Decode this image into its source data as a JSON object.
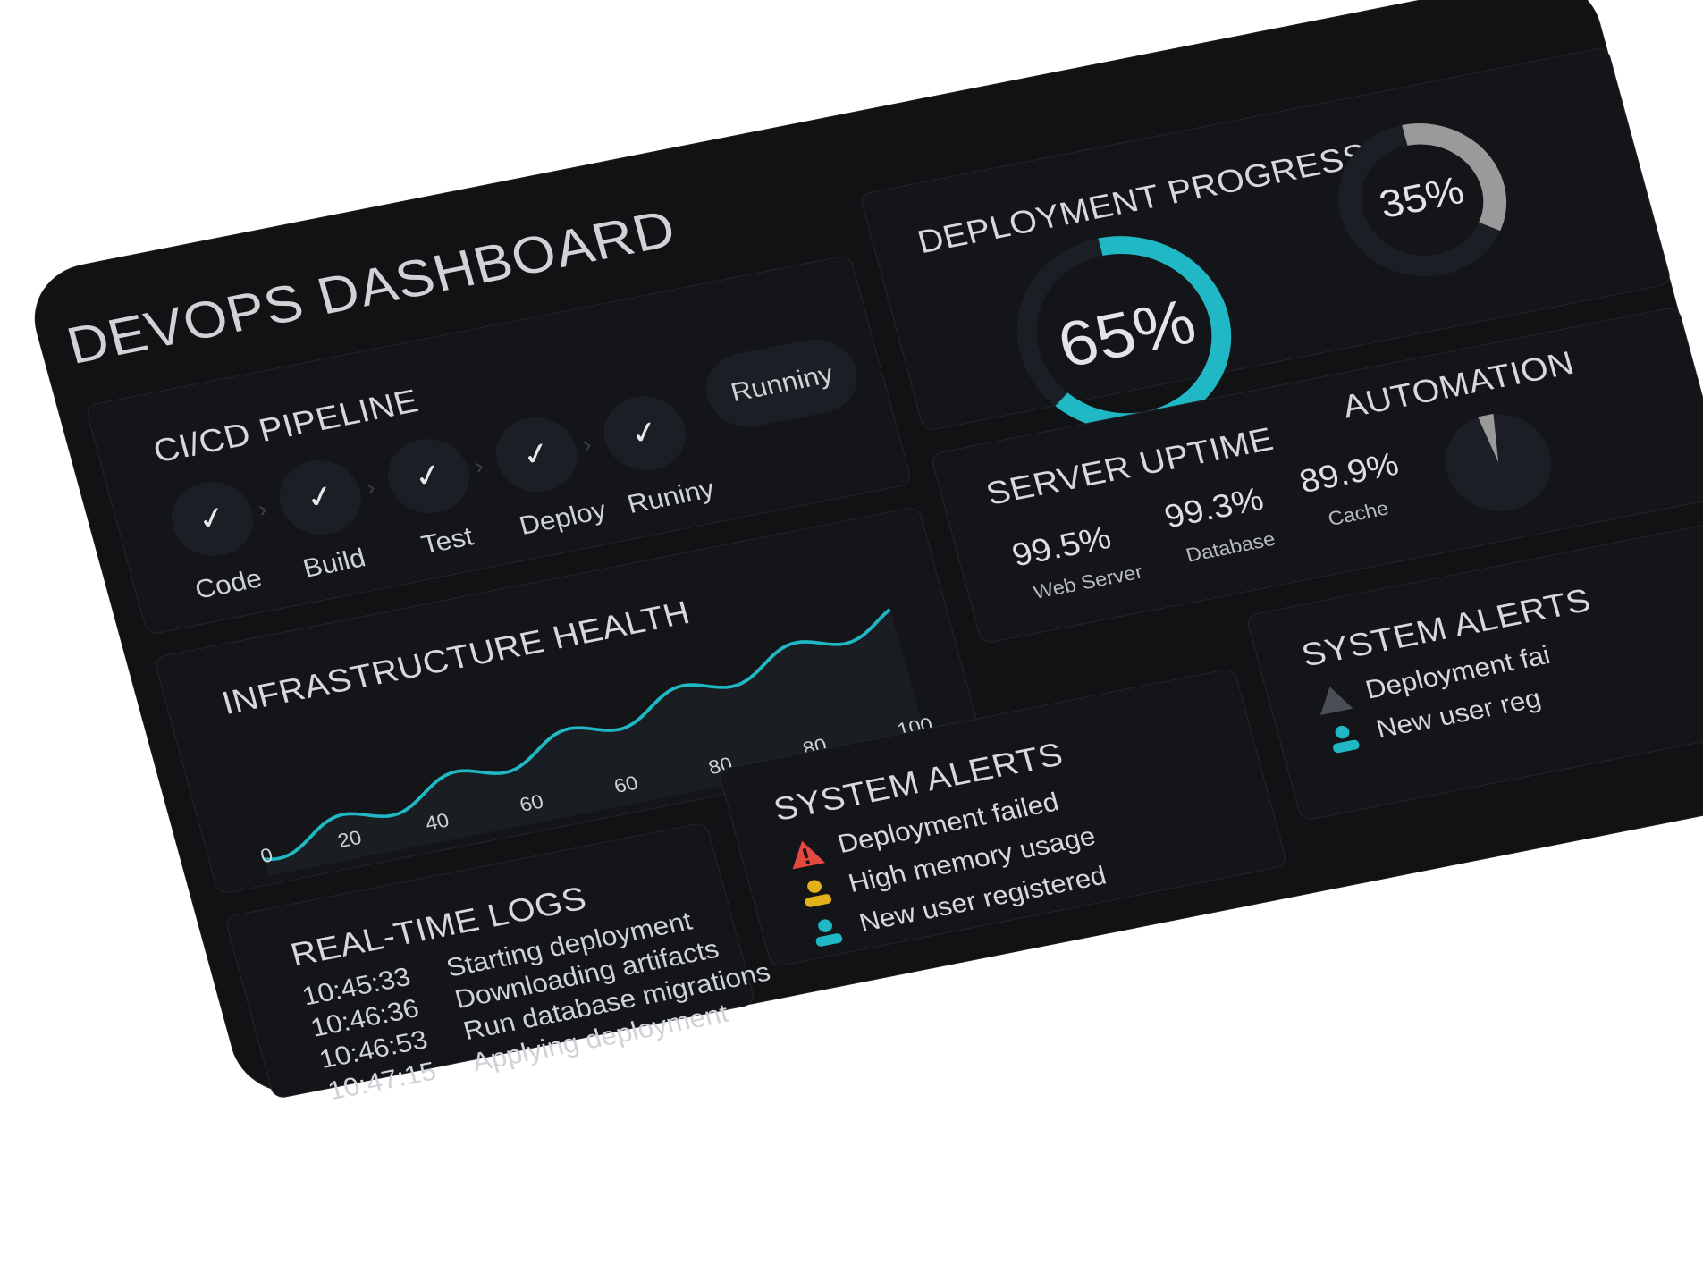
{
  "page_title": "DEVOPS DASHBOARD",
  "pipeline": {
    "title": "CI/CD PIPELINE",
    "stages": [
      {
        "label": "Code",
        "mark": "✓"
      },
      {
        "label": "Build",
        "mark": "✓"
      },
      {
        "label": "Test",
        "mark": "✓"
      },
      {
        "label": "Deploy",
        "mark": "✓"
      },
      {
        "label": "Runiny",
        "mark": "✓"
      }
    ],
    "status_pill": "Runniny"
  },
  "deployment": {
    "title": "DEPLOYMENT PROGRESS",
    "primary": {
      "value": 0.65,
      "label": "65%",
      "color": "#1fb8c4"
    },
    "secondary": {
      "value": 0.35,
      "label": "35%",
      "color": "#9a9a9a"
    }
  },
  "infrastructure": {
    "title": "INFRASTRUCTURE HEALTH",
    "ticks": [
      "0",
      "20",
      "40",
      "60",
      "60",
      "80",
      "80",
      "100"
    ],
    "line_color": "#1fb8c4"
  },
  "uptime": {
    "title": "SERVER UPTIME",
    "items": [
      {
        "value": "99.5%",
        "label": "Web Server"
      },
      {
        "value": "99.3%",
        "label": "Database"
      },
      {
        "value": "89.9%",
        "label": "Cache"
      }
    ]
  },
  "automation": {
    "title": "AUTOMATION"
  },
  "logs": {
    "title": "REAL-TIME LOGS",
    "rows": [
      {
        "time": "10:45:33",
        "message": "Starting deployment"
      },
      {
        "time": "10:46:36",
        "message": "Downloading artifacts"
      },
      {
        "time": "10:46:53",
        "message": "Run database migrations"
      },
      {
        "time": "10:47:15",
        "message": "Applying deployment"
      }
    ]
  },
  "alerts": {
    "title": "SYSTEM ALERTS",
    "rows": [
      {
        "icon": "warning-triangle-icon",
        "text": "Deployment failed",
        "color": "#e5483f"
      },
      {
        "icon": "user-icon",
        "text": "High memory usage",
        "color": "#e3b21b"
      },
      {
        "icon": "user-icon",
        "text": "New user registered",
        "color": "#1fb8c4"
      }
    ]
  },
  "alerts_secondary": {
    "title": "SYSTEM ALERTS",
    "rows": [
      {
        "icon": "warning-triangle-icon",
        "text": "Deployment fai",
        "color": "#4a4e55"
      },
      {
        "icon": "user-icon",
        "text": "New user reg",
        "color": "#1fb8c4"
      }
    ]
  }
}
